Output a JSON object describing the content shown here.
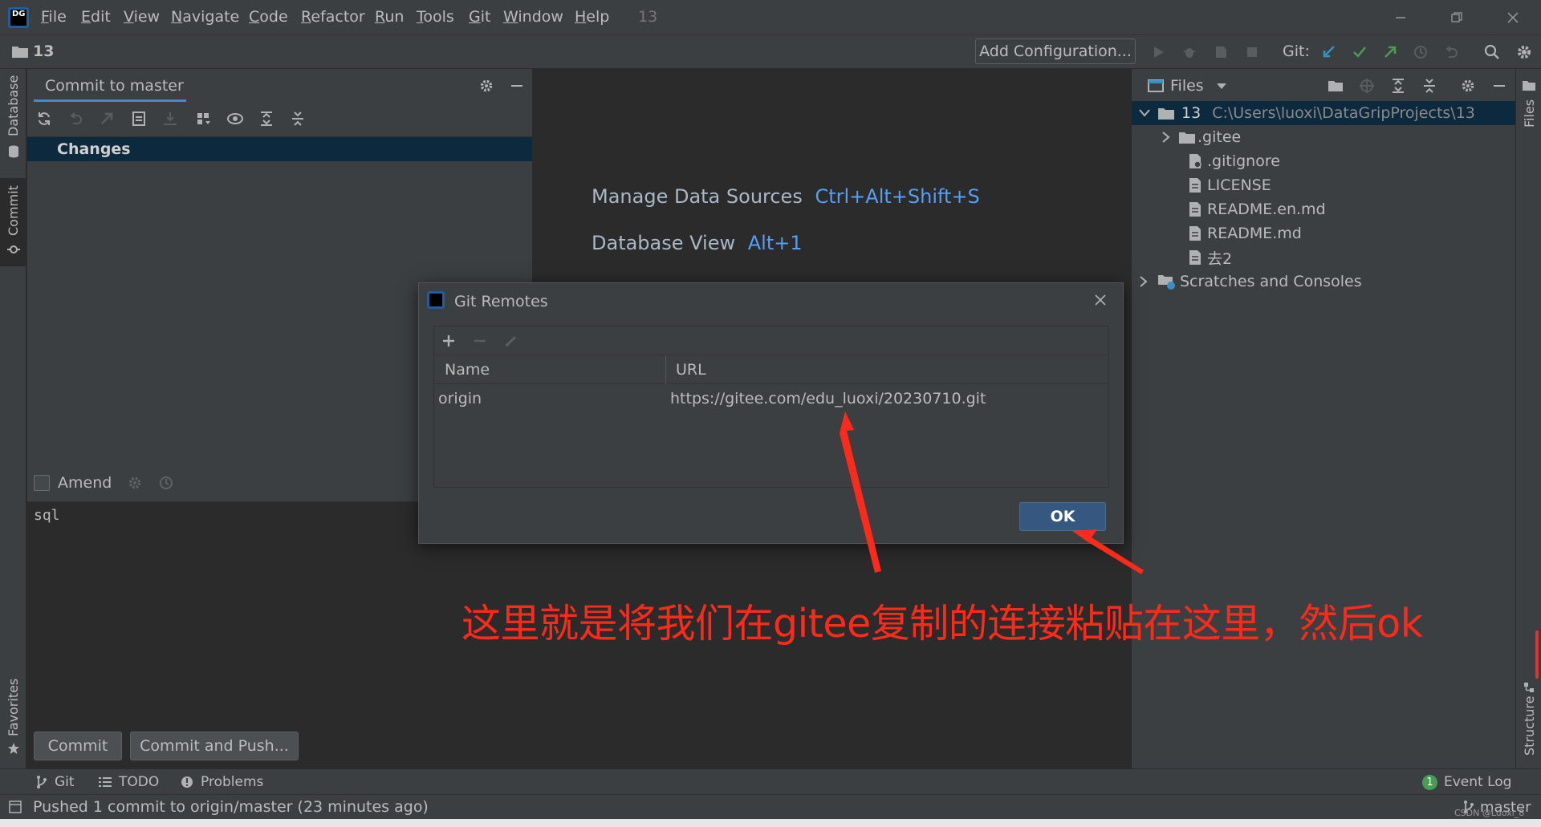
{
  "app": {
    "logo_text": "DG",
    "project_name": "13"
  },
  "menu": {
    "items": [
      {
        "label": "File",
        "mnemonic": "F",
        "rest": "ile"
      },
      {
        "label": "Edit",
        "mnemonic": "E",
        "rest": "dit"
      },
      {
        "label": "View",
        "mnemonic": "V",
        "rest": "iew"
      },
      {
        "label": "Navigate",
        "mnemonic": "N",
        "rest": "avigate"
      },
      {
        "label": "Code",
        "mnemonic": "C",
        "rest": "ode"
      },
      {
        "label": "Refactor",
        "mnemonic": "R",
        "rest": "efactor"
      },
      {
        "label": "Run",
        "mnemonic": "R",
        "rest": "un"
      },
      {
        "label": "Tools",
        "mnemonic": "T",
        "rest": "ools"
      },
      {
        "label": "Git",
        "mnemonic": "G",
        "rest": "it"
      },
      {
        "label": "Window",
        "mnemonic": "W",
        "rest": "indow"
      },
      {
        "label": "Help",
        "mnemonic": "H",
        "rest": "elp"
      }
    ]
  },
  "navbar": {
    "project": "13",
    "add_config_label": "Add Configuration...",
    "git_label": "Git:"
  },
  "left_stripe": {
    "database_label": "Database",
    "commit_label": "Commit",
    "favorites_label": "Favorites"
  },
  "right_stripe": {
    "files_label": "Files",
    "structure_label": "Structure"
  },
  "commit_panel": {
    "tab_label": "Commit to master",
    "changes_label": "Changes",
    "amend_label": "Amend",
    "message": "sql",
    "commit_button": "Commit",
    "commit_push_button": "Commit and Push..."
  },
  "editor": {
    "hints": [
      {
        "label": "Manage Data Sources",
        "shortcut": "Ctrl+Alt+Shift+S"
      },
      {
        "label": "Database View",
        "shortcut": "Alt+1"
      }
    ]
  },
  "project": {
    "header_label": "Files",
    "root_name": "13",
    "root_path": "C:\\Users\\luoxi\\DataGripProjects\\13",
    "items": [
      ".gitee",
      ".gitignore",
      "LICENSE",
      "README.en.md",
      "README.md",
      "去2"
    ],
    "scratches_label": "Scratches and Consoles"
  },
  "dialog": {
    "title": "Git Remotes",
    "columns": [
      "Name",
      "URL"
    ],
    "rows": [
      {
        "name": "origin",
        "url": "https://gitee.com/edu_luoxi/20230710.git"
      }
    ],
    "ok_label": "OK"
  },
  "annotation": {
    "text": "这里就是将我们在gitee复制的连接粘贴在这里，然后ok",
    "color": "#ff2a1a"
  },
  "bottom_tools": {
    "git": "Git",
    "todo": "TODO",
    "problems": "Problems",
    "event_log": "Event Log",
    "event_count": "1"
  },
  "status": {
    "message": "Pushed 1 commit to origin/master (23 minutes ago)",
    "branch": "master",
    "watermark": "CSDN @Luoxi_8"
  },
  "colors": {
    "accent": "#589df6",
    "selection": "#0d293e",
    "link": "#589df6",
    "ok_button": "#365880"
  }
}
